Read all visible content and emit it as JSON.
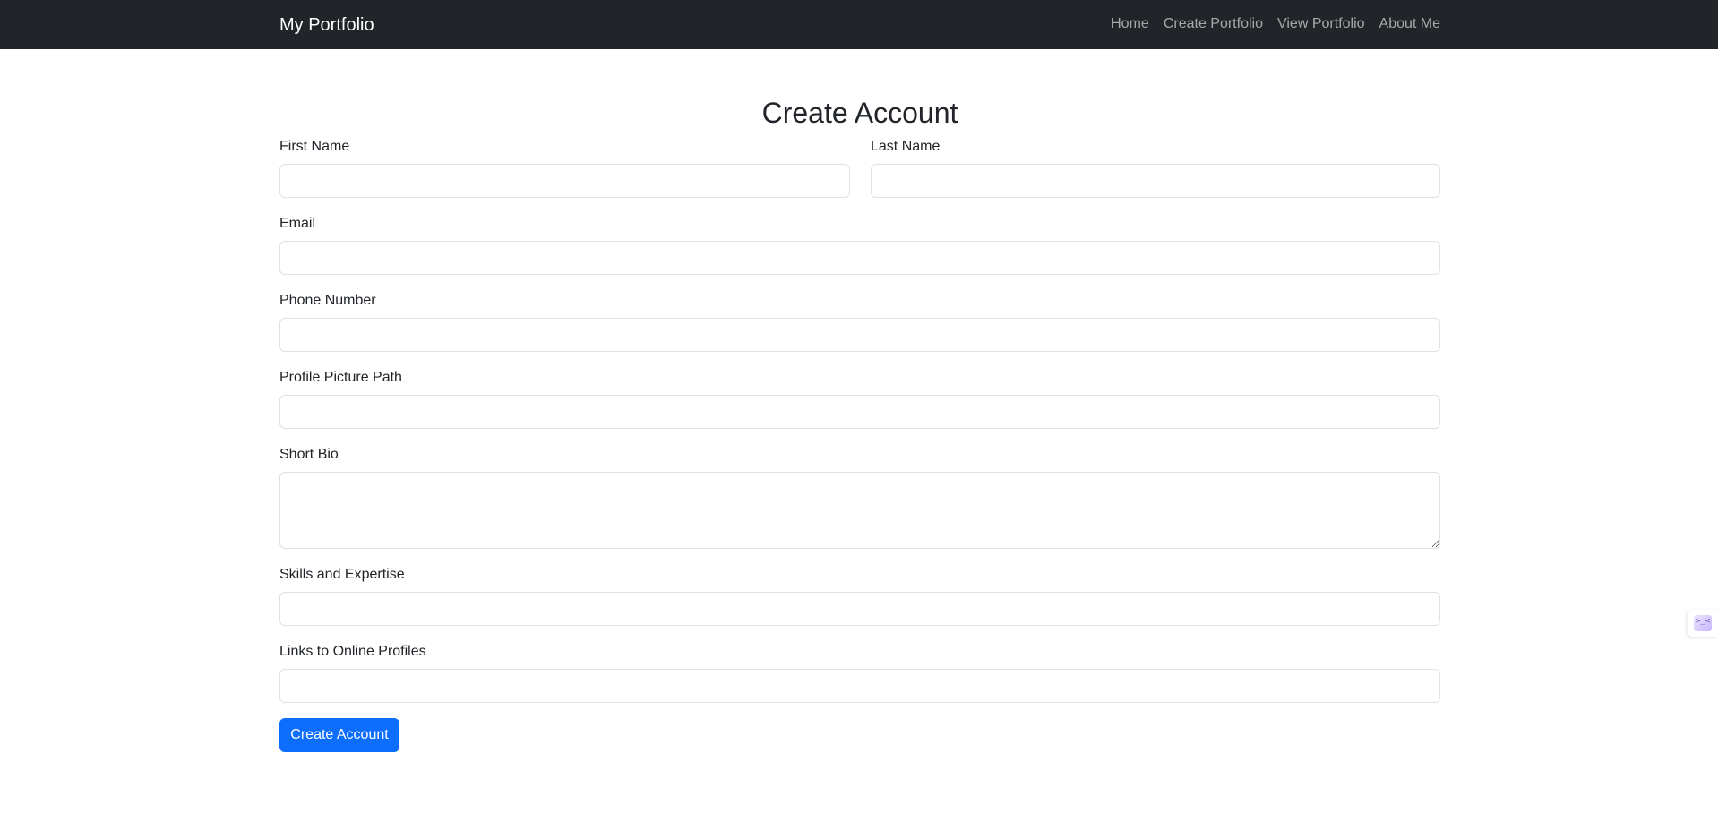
{
  "navbar": {
    "brand": "My Portfolio",
    "links": [
      {
        "label": "Home"
      },
      {
        "label": "Create Portfolio"
      },
      {
        "label": "View Portfolio"
      },
      {
        "label": "About Me"
      }
    ]
  },
  "page": {
    "title": "Create Account"
  },
  "form": {
    "first_name": {
      "label": "First Name",
      "value": "",
      "placeholder": ""
    },
    "last_name": {
      "label": "Last Name",
      "value": "",
      "placeholder": ""
    },
    "email": {
      "label": "Email",
      "value": "",
      "placeholder": ""
    },
    "phone": {
      "label": "Phone Number",
      "value": "",
      "placeholder": ""
    },
    "profile_picture": {
      "label": "Profile Picture Path",
      "value": "",
      "placeholder": ""
    },
    "short_bio": {
      "label": "Short Bio",
      "value": "",
      "placeholder": ""
    },
    "skills": {
      "label": "Skills and Expertise",
      "value": "",
      "placeholder": ""
    },
    "links": {
      "label": "Links to Online Profiles",
      "value": "",
      "placeholder": ""
    },
    "submit_label": "Create Account"
  },
  "side_widget": {
    "icon": "terminal-icon",
    "glyph": ">_<"
  },
  "colors": {
    "navbar_bg": "#212529",
    "primary": "#0d6efd",
    "input_border": "#dee2e6"
  }
}
